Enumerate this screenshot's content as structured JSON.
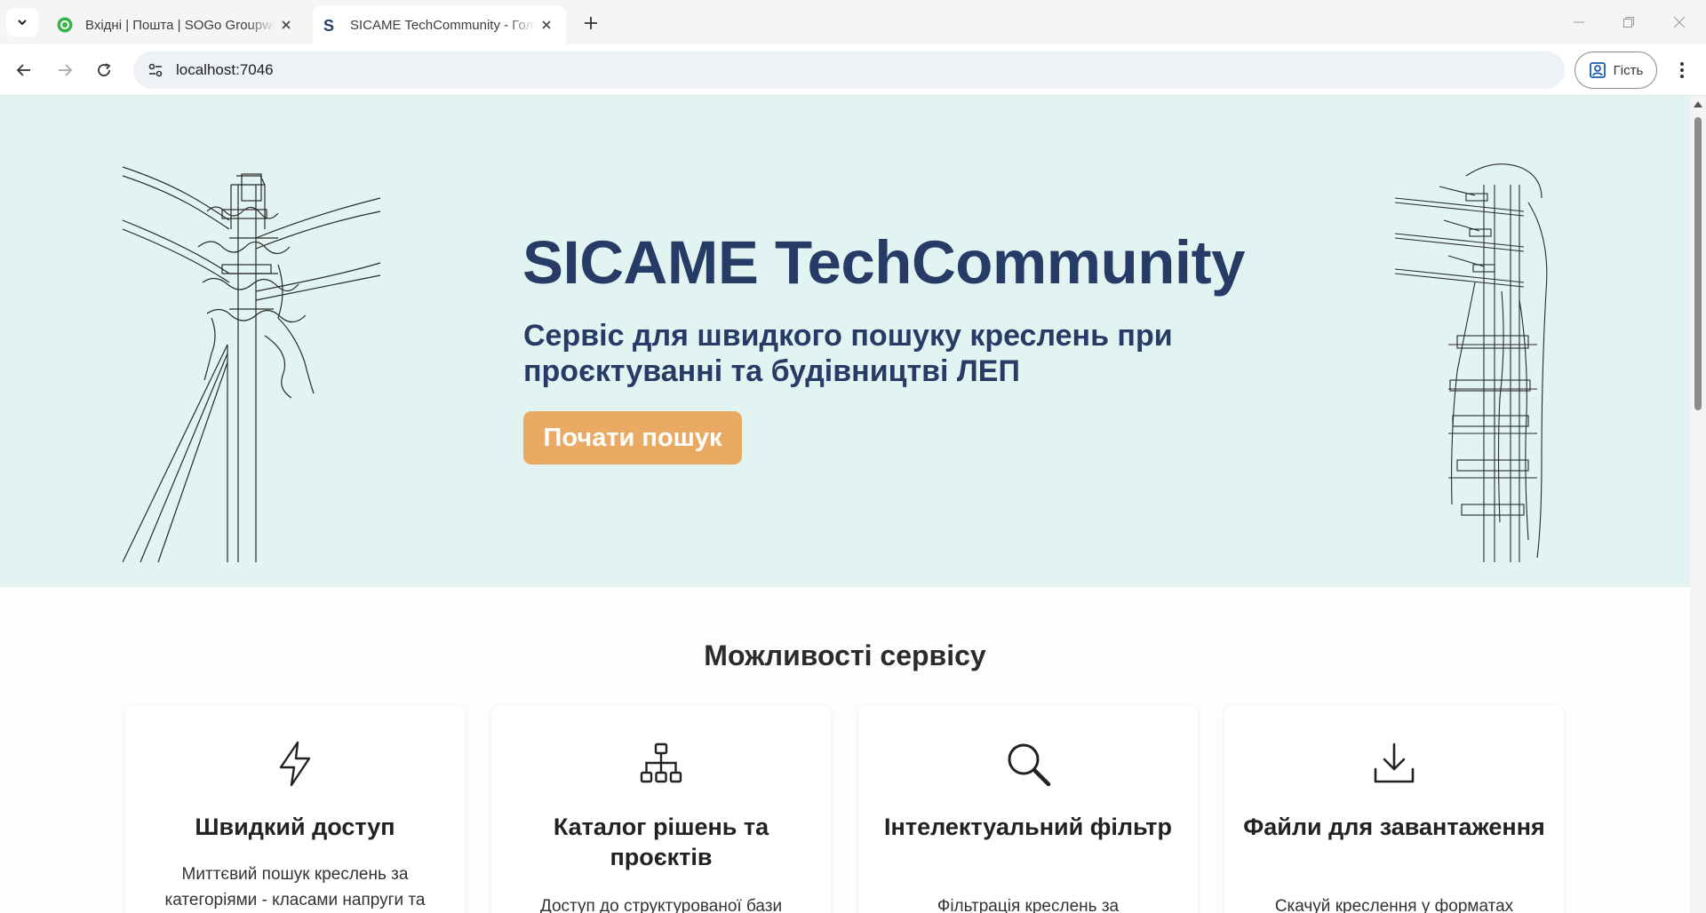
{
  "browser": {
    "tabs": [
      {
        "title": "Вхідні | Пошта | SOGo Groupware",
        "active": false,
        "favicon": "sogo-icon"
      },
      {
        "title": "SICAME TechCommunity - Головна",
        "active": true,
        "favicon": "sicame-s-icon"
      }
    ],
    "url": "localhost:7046",
    "profile_label": "Гість"
  },
  "hero": {
    "title": "SICAME TechCommunity",
    "subtitle": "Сервіс для швидкого пошуку креслень при проєктуванні та будівництві ЛЕП",
    "cta_label": "Почати пошук"
  },
  "features": {
    "title": "Можливості сервісу",
    "cards": [
      {
        "icon": "lightning-icon",
        "title": "Швидкий доступ",
        "desc_line1": "Миттєвий пошук креслень за",
        "desc_line2": "категоріями - класами напруги та"
      },
      {
        "icon": "sitemap-icon",
        "title": "Каталог рішень та проєктів",
        "desc_line1": "Доступ до структурованої бази",
        "desc_line2": ""
      },
      {
        "icon": "search-icon",
        "title": "Інтелектуальний фільтр",
        "desc_line1": "Фільтрація креслень за",
        "desc_line2": ""
      },
      {
        "icon": "download-icon",
        "title": "Файли для завантаження",
        "desc_line1": "Скачуй креслення у форматах",
        "desc_line2": ""
      }
    ]
  },
  "colors": {
    "hero_bg": "#e2f4f1",
    "heading": "#273b67",
    "cta": "#eaaa63"
  }
}
